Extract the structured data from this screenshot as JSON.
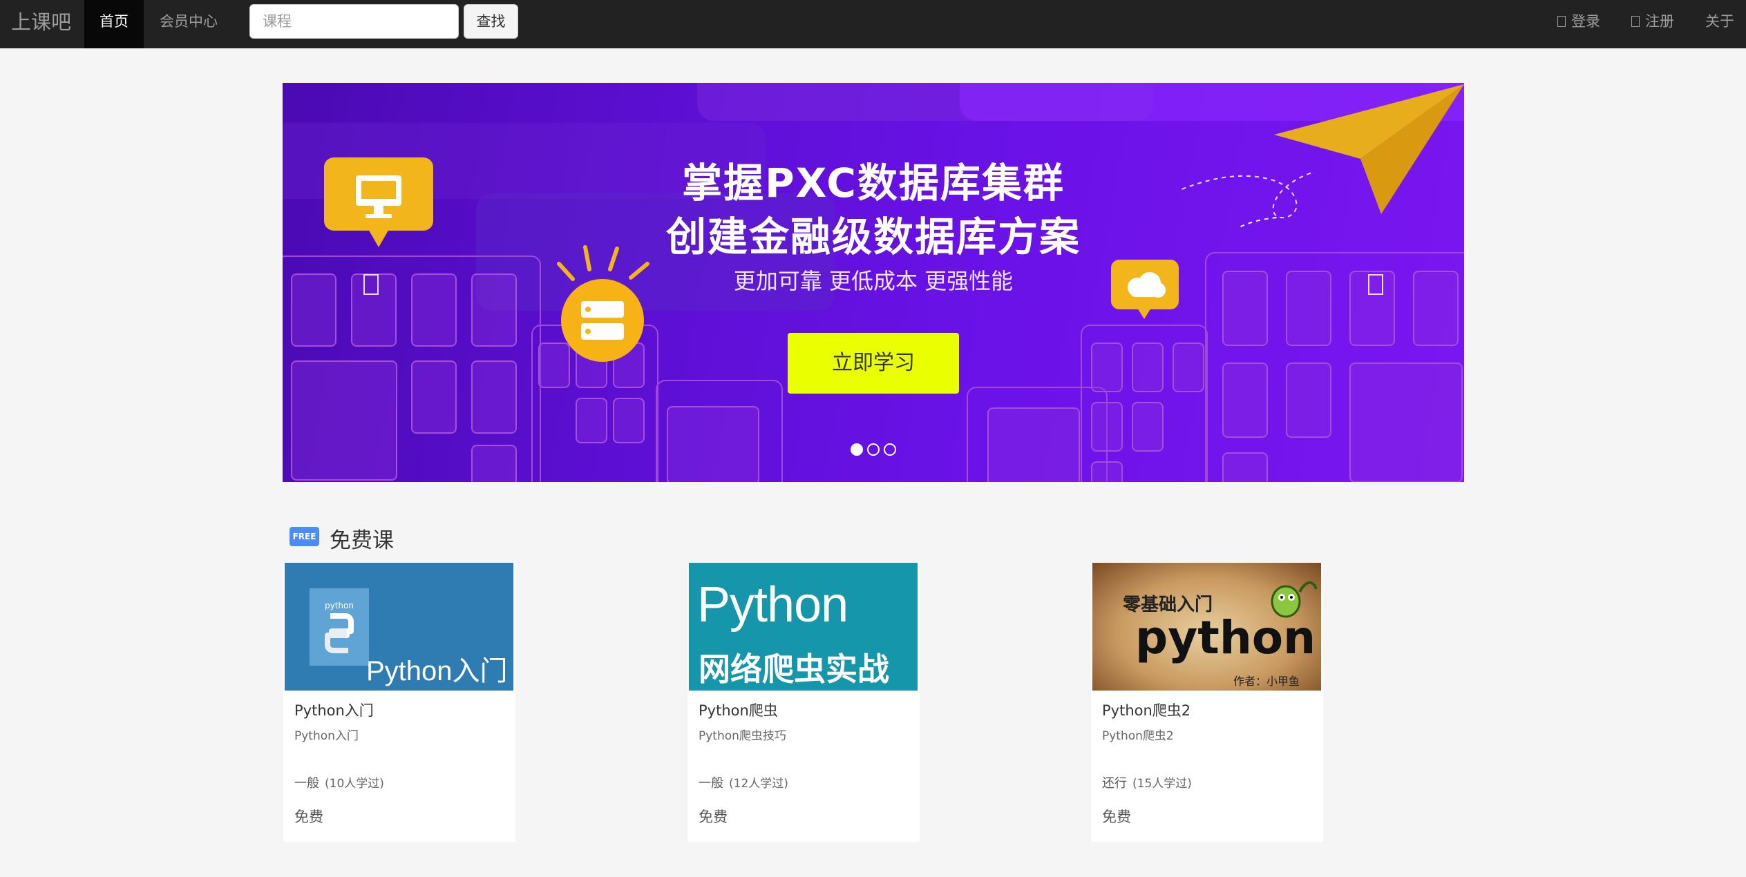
{
  "navbar": {
    "brand": "上课吧",
    "items": [
      {
        "label": "首页",
        "active": true
      },
      {
        "label": "会员中心",
        "active": false
      }
    ],
    "search": {
      "placeholder": "课程",
      "button_label": "查找"
    },
    "right": {
      "login": "登录",
      "register": "注册",
      "about": "关于"
    }
  },
  "carousel": {
    "title_line1": "掌握PXC数据库集群",
    "title_line2": "创建金融级数据库方案",
    "subtitle": "更加可靠 更低成本 更强性能",
    "button_label": "立即学习",
    "indicator_count": 3,
    "active_index": 0
  },
  "section": {
    "badge": "FREE",
    "title": "免费课"
  },
  "courses": [
    {
      "thumb_text": "Python入门",
      "thumb_logo_text": "python",
      "title": "Python入门",
      "desc": "Python入门",
      "level": "一般",
      "learned": "(10人学过)",
      "price": "免费"
    },
    {
      "thumb_text_line1": "Python",
      "thumb_text_line2": "网络爬虫实战",
      "title": "Python爬虫",
      "desc": "Python爬虫技巧",
      "level": "一般",
      "learned": "(12人学过)",
      "price": "免费"
    },
    {
      "thumb_text_line1": "零基础入门",
      "thumb_text_line2": "python",
      "thumb_text_line3": "作者：小甲鱼",
      "title": "Python爬虫2",
      "desc": "Python爬虫2",
      "level": "还行",
      "learned": "(15人学过)",
      "price": "免费"
    }
  ],
  "colors": {
    "navbar_bg": "#222222",
    "banner_purple": "#6a12e8",
    "banner_button": "#eaff00",
    "badge_blue": "#4b8cf5"
  }
}
